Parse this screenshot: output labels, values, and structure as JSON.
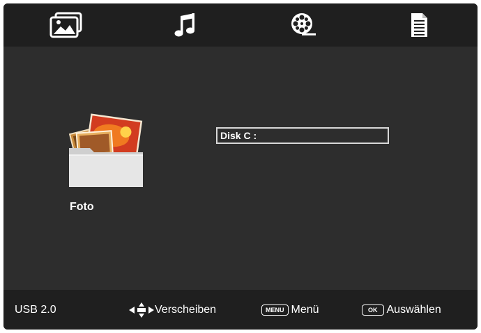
{
  "tabs": [
    {
      "icon": "photo-icon"
    },
    {
      "icon": "music-note-icon"
    },
    {
      "icon": "film-reel-icon"
    },
    {
      "icon": "document-icon"
    }
  ],
  "main": {
    "category_label": "Foto",
    "category_icon": "photo-folder-icon",
    "disk_label": "Disk C :"
  },
  "footer": {
    "source": "USB 2.0",
    "move_label": "Verscheiben",
    "menu_key": "MENU",
    "menu_label": "Menü",
    "ok_key": "OK",
    "select_label": "Auswählen"
  },
  "colors": {
    "background": "#2d2d2d",
    "bars": "#1f1f1f",
    "text": "#ffffff",
    "selection_border": "#d8d8d8"
  }
}
